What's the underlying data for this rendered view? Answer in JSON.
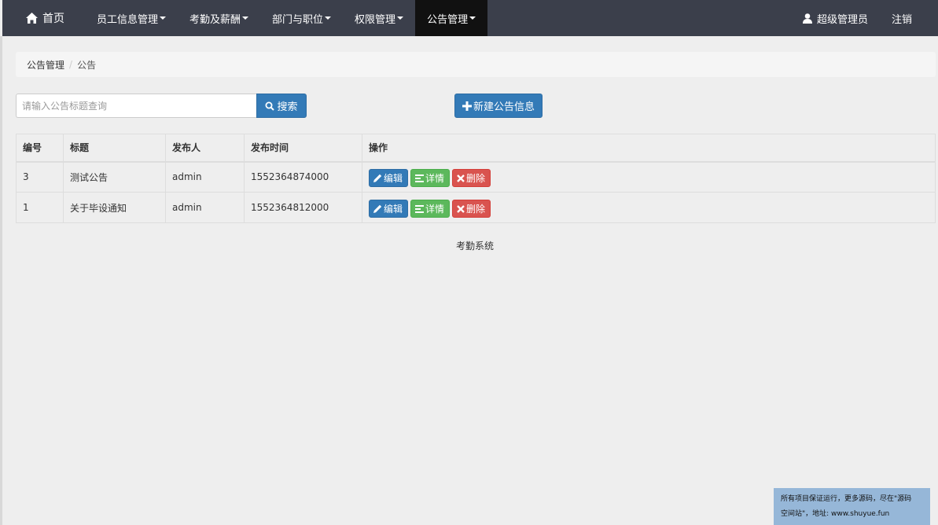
{
  "navbar": {
    "home_label": "首页",
    "menus": [
      {
        "label": "员工信息管理"
      },
      {
        "label": "考勤及薪酬"
      },
      {
        "label": "部门与职位"
      },
      {
        "label": "权限管理"
      },
      {
        "label": "公告管理"
      }
    ],
    "active_menu": "公告管理",
    "user_label": "超级管理员",
    "logout_label": "注销",
    "bg_color": "#3b3f4b"
  },
  "breadcrumb": {
    "items": [
      "公告管理",
      "公告"
    ],
    "separator": "/"
  },
  "search": {
    "placeholder": "请输入公告标题查询",
    "button_label": "搜索"
  },
  "new_button_label": "新建公告信息",
  "table": {
    "headers": [
      "编号",
      "标题",
      "发布人",
      "发布时间",
      "操作"
    ],
    "rows": [
      {
        "id": "3",
        "title": "测试公告",
        "publisher": "admin",
        "time": "1552364874000"
      },
      {
        "id": "1",
        "title": "关于毕设通知",
        "publisher": "admin",
        "time": "1552364812000"
      }
    ],
    "actions": {
      "edit": "编辑",
      "detail": "详情",
      "delete": "删除"
    }
  },
  "footer": "考勤系统",
  "promo": {
    "line1": "所有项目保证运行，更多源码，尽在\"源码",
    "line2": "空间站\"，地址: www.shuyue.fun"
  },
  "colors": {
    "primary": "#337ab7",
    "success": "#5cb85c",
    "danger": "#d9534f",
    "active_nav": "#111111"
  }
}
